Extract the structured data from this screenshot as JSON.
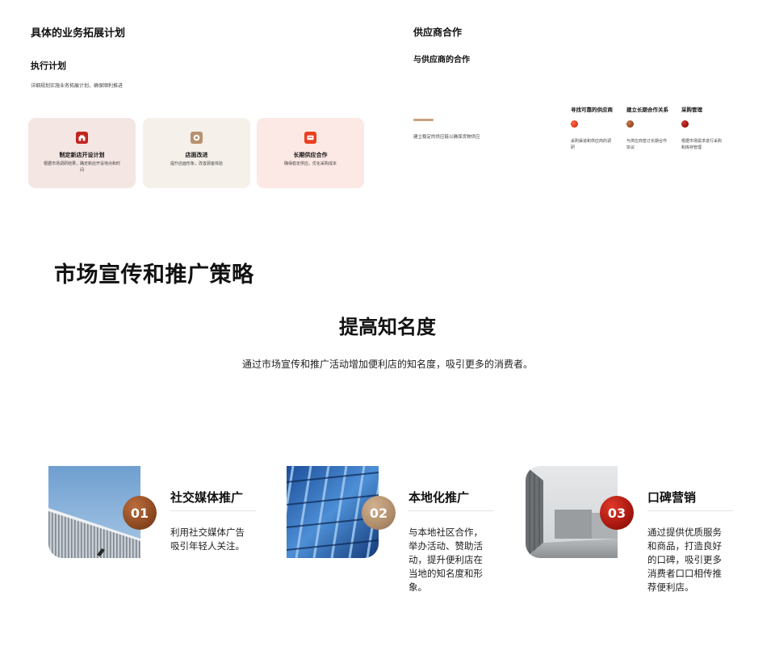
{
  "plan": {
    "title": "具体的业务拓展计划",
    "subtitle": "执行计划",
    "description": "详细规划实施业务拓展计划，确保顺利推进",
    "cards": [
      {
        "icon": "store-icon",
        "title": "制定新店开设计划",
        "desc": "根据市场调研结果，确定新店开设地点和时间",
        "bg": "#f4e6e3",
        "icon_color": "#c0261f"
      },
      {
        "icon": "target-icon",
        "title": "店面改进",
        "desc": "提升店面形象，改善顾客体验",
        "bg": "#f5f0ea",
        "icon_color": "#b8916f"
      },
      {
        "icon": "handshake-icon",
        "title": "长期供应合作",
        "desc": "确保稳定供应，优化采购成本",
        "bg": "#fce8e4",
        "icon_color": "#e8401f"
      }
    ]
  },
  "supplier": {
    "title": "供应商合作",
    "subtitle": "与供应商的合作",
    "description": "建立稳定的供应链以确保货物供应",
    "steps": [
      {
        "title": "寻找可靠的供应商",
        "desc": "采购渠道和供应商的调研",
        "color": "#e23a1c"
      },
      {
        "title": "建立长期合作关系",
        "desc": "与供应商签订长期合作协议",
        "color": "#9b4a25"
      },
      {
        "title": "采购管理",
        "desc": "根据市场需求进行采购和库存管理",
        "color": "#9a1414"
      }
    ]
  },
  "marketing": {
    "title": "市场宣传和推广策略",
    "subtitle": "提高知名度",
    "description": "通过市场宣传和推广活动增加便利店的知名度，吸引更多的消费者。",
    "strategies": [
      {
        "number": "01",
        "title": "社交媒体推广",
        "desc": "利用社交媒体广告吸引年轻人关注。",
        "color": "#8e4a22",
        "photo": "building-photo-sky"
      },
      {
        "number": "02",
        "title": "本地化推广",
        "desc": "与本地社区合作，举办活动、赞助活动，提升便利店在当地的知名度和形象。",
        "color": "#b08e6c",
        "photo": "building-photo-glass"
      },
      {
        "number": "03",
        "title": "口碑营销",
        "desc": "通过提供优质服务和商品，打造良好的口碑，吸引更多消费者口口相传推荐便利店。",
        "color": "#a8180f",
        "photo": "building-photo-concrete"
      }
    ]
  }
}
